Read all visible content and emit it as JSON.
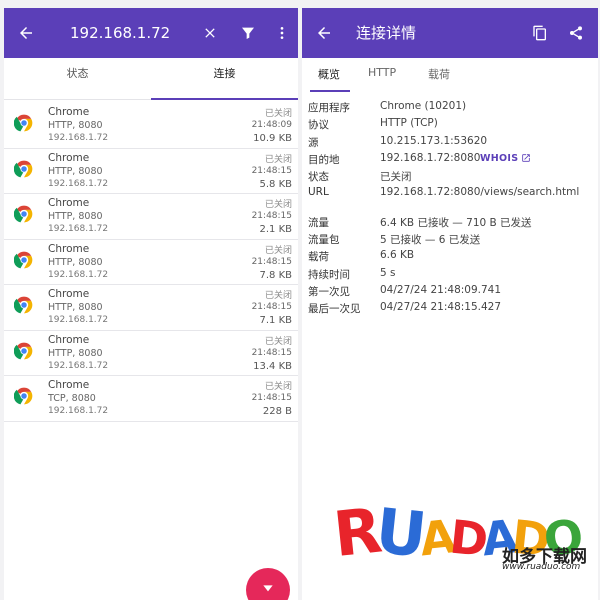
{
  "left": {
    "header": {
      "title": "192.168.1.72"
    },
    "tabs": [
      {
        "label": "状态",
        "active": false
      },
      {
        "label": "连接",
        "active": true
      }
    ],
    "connections": [
      {
        "app": "Chrome",
        "protocol": "HTTP, 8080",
        "address": "192.168.1.72",
        "status": "已关闭",
        "time": "21:48:09",
        "size": "10.9 KB"
      },
      {
        "app": "Chrome",
        "protocol": "HTTP, 8080",
        "address": "192.168.1.72",
        "status": "已关闭",
        "time": "21:48:15",
        "size": "5.8 KB"
      },
      {
        "app": "Chrome",
        "protocol": "HTTP, 8080",
        "address": "192.168.1.72",
        "status": "已关闭",
        "time": "21:48:15",
        "size": "2.1 KB"
      },
      {
        "app": "Chrome",
        "protocol": "HTTP, 8080",
        "address": "192.168.1.72",
        "status": "已关闭",
        "time": "21:48:15",
        "size": "7.8 KB"
      },
      {
        "app": "Chrome",
        "protocol": "HTTP, 8080",
        "address": "192.168.1.72",
        "status": "已关闭",
        "time": "21:48:15",
        "size": "7.1 KB"
      },
      {
        "app": "Chrome",
        "protocol": "HTTP, 8080",
        "address": "192.168.1.72",
        "status": "已关闭",
        "time": "21:48:15",
        "size": "13.4 KB"
      },
      {
        "app": "Chrome",
        "protocol": "TCP, 8080",
        "address": "192.168.1.72",
        "status": "已关闭",
        "time": "21:48:15",
        "size": "228 B"
      }
    ]
  },
  "right": {
    "header": {
      "title": "连接详情"
    },
    "tabs": [
      {
        "label": "概览",
        "active": true
      },
      {
        "label": "HTTP",
        "active": false
      },
      {
        "label": "载荷",
        "active": false
      }
    ],
    "details_a": [
      {
        "key": "应用程序",
        "value": "Chrome (10201)"
      },
      {
        "key": "协议",
        "value": "HTTP (TCP)"
      },
      {
        "key": "源",
        "value": "10.215.173.1:53620"
      },
      {
        "key": "目的地",
        "value": "192.168.1.72:8080"
      },
      {
        "key": "状态",
        "value": "已关闭"
      },
      {
        "key": "URL",
        "value": "192.168.1.72:8080/views/search.html"
      }
    ],
    "whois_label": "WHOIS",
    "details_b": [
      {
        "key": "流量",
        "value": "6.4 KB 已接收 — 710 B 已发送"
      },
      {
        "key": "流量包",
        "value": "5 已接收 — 6 已发送"
      },
      {
        "key": "载荷",
        "value": "6.6 KB"
      },
      {
        "key": "持续时间",
        "value": "5 s"
      },
      {
        "key": "第一次见",
        "value": "04/27/24 21:48:09.741"
      },
      {
        "key": "最后一次见",
        "value": "04/27/24 21:48:15.427"
      }
    ]
  },
  "watermark": {
    "letters": "RUADADO",
    "cn": "如多下载网",
    "url": "www.ruaduo.com"
  },
  "colors": {
    "accent": "#5b3fb8",
    "fab": "#e5285a"
  }
}
